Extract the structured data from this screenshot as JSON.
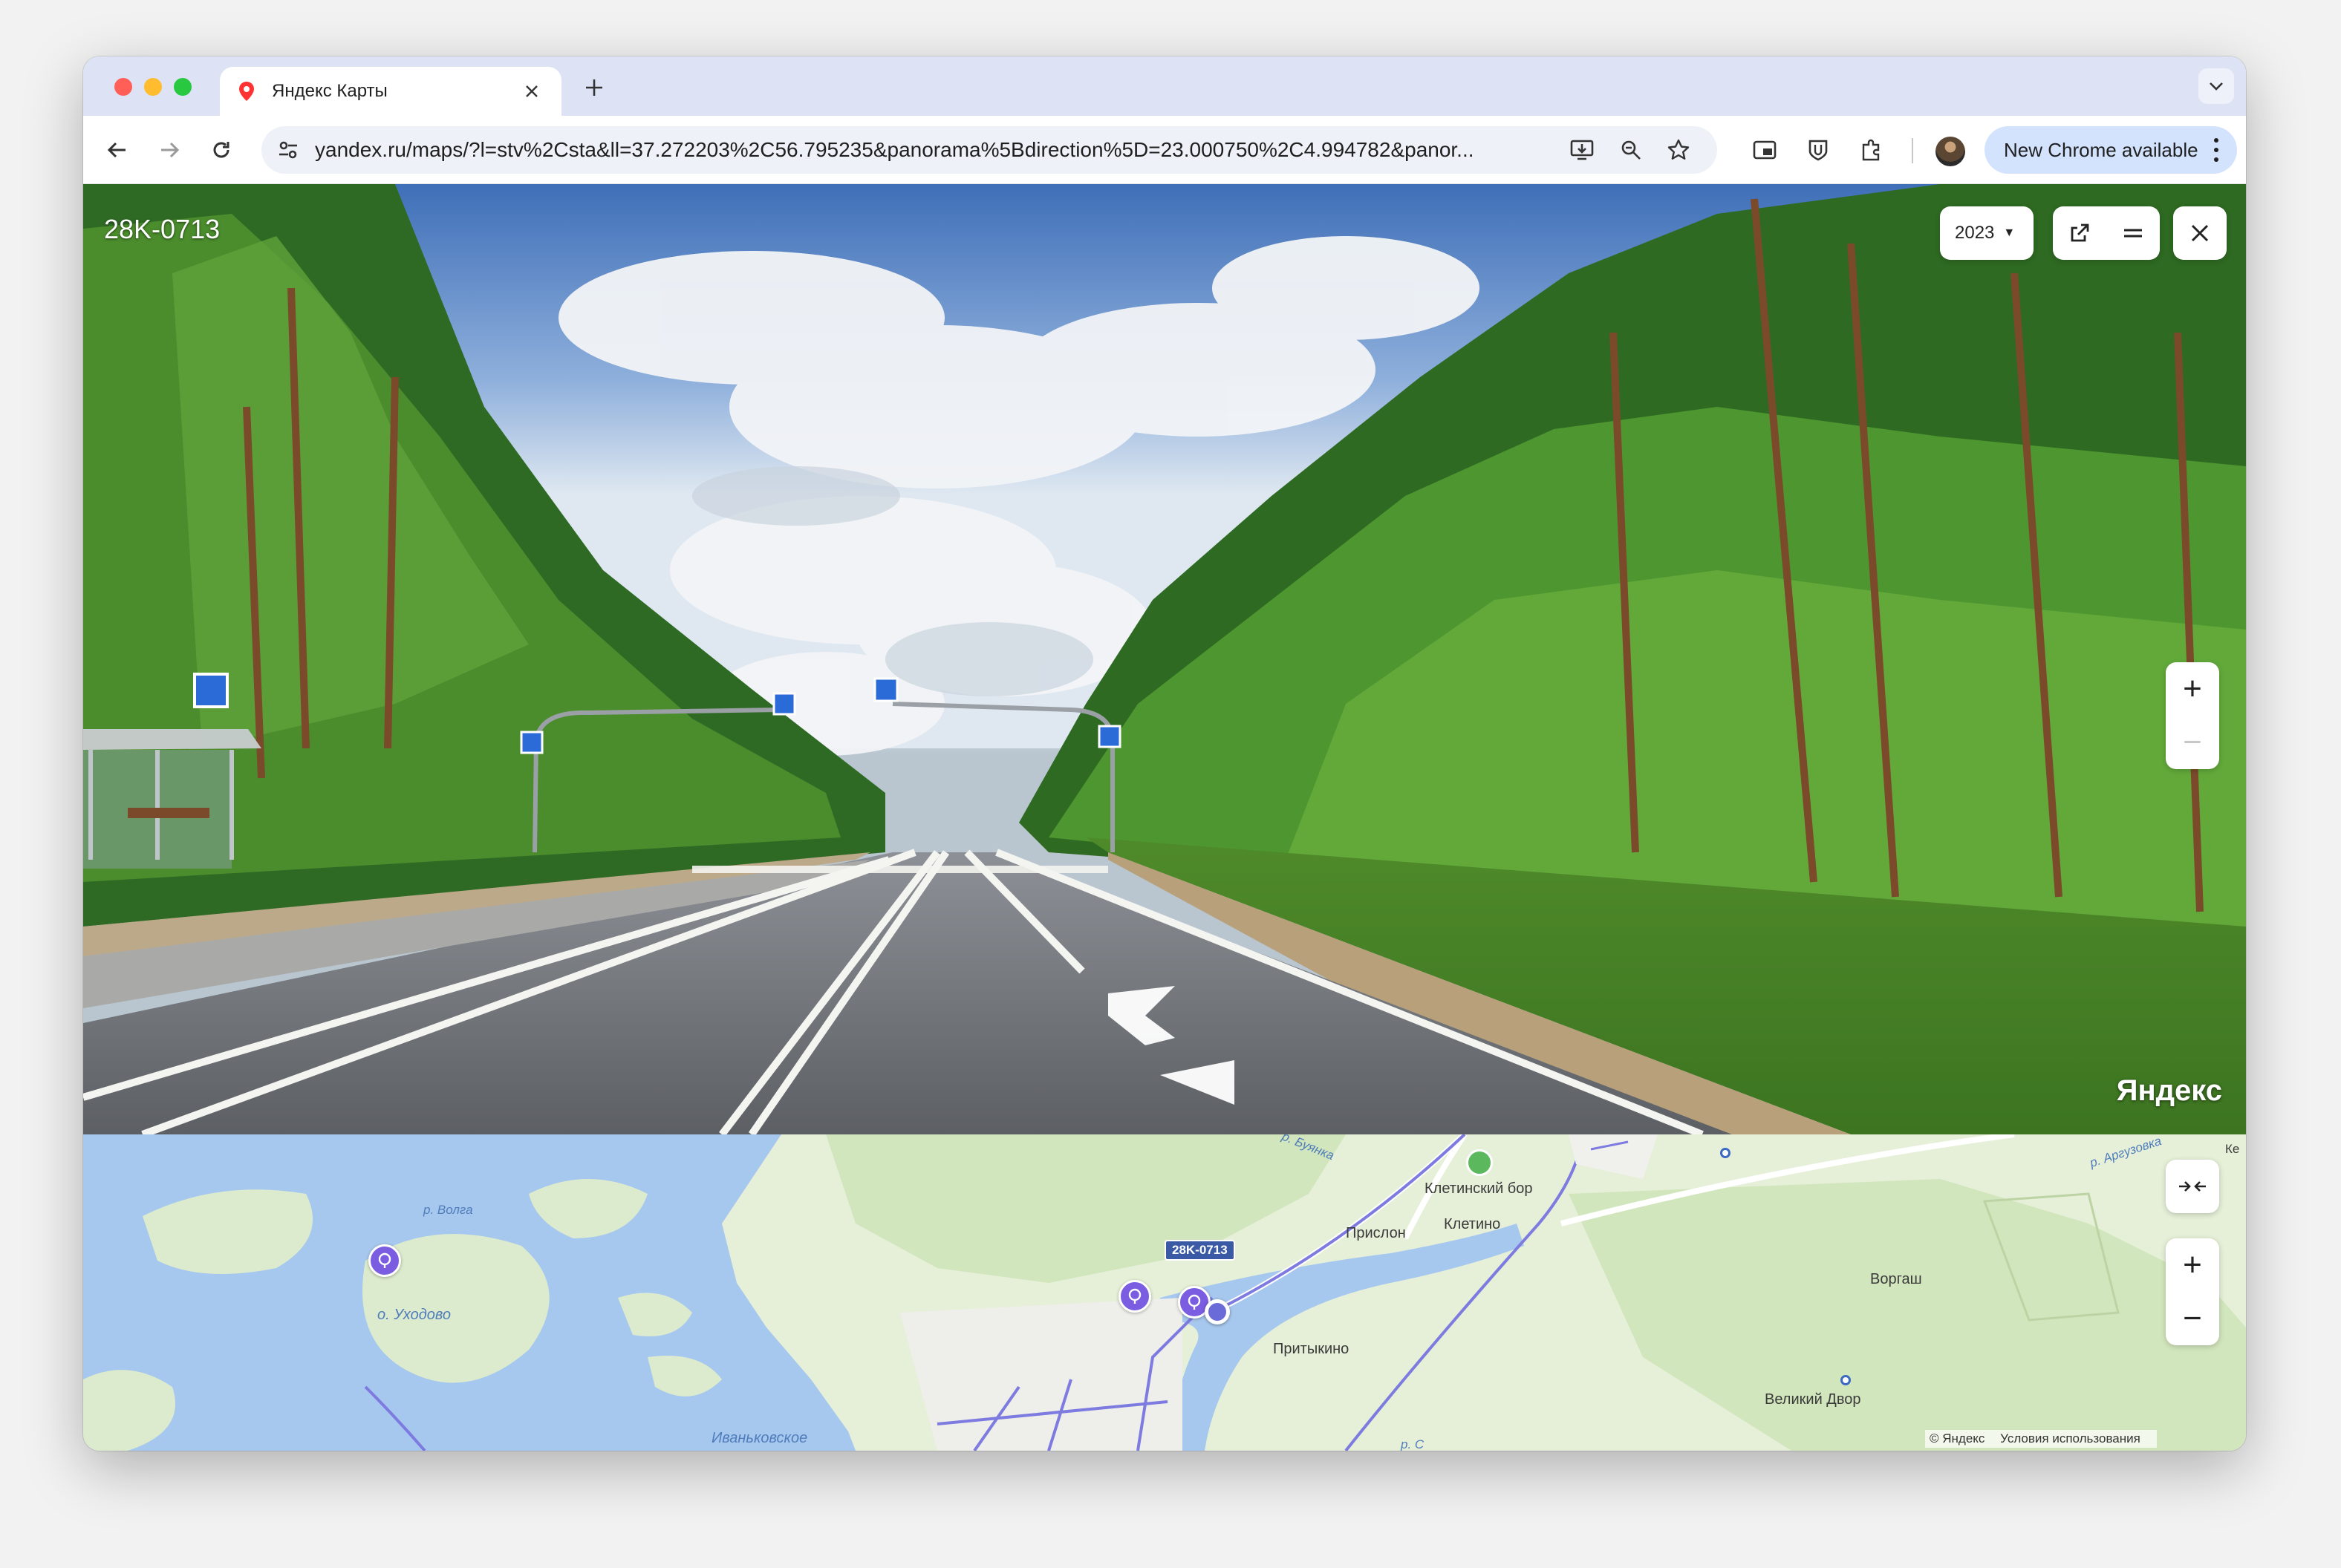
{
  "browser": {
    "tab": {
      "title": "Яндекс Карты"
    },
    "url": "yandex.ru/maps/?l=stv%2Csta&ll=37.272203%2C56.795235&panorama%5Bdirection%5D=23.000750%2C4.994782&panor...",
    "update_label": "New Chrome available"
  },
  "panorama": {
    "road_label": "28K-0713",
    "year": "2023",
    "watermark": "Яндекс",
    "zoom_in": "+",
    "zoom_out": "−"
  },
  "map": {
    "labels": {
      "volga": "р. Волга",
      "uhodovo": "о. Уходово",
      "ivankovskoe": "Иваньковское",
      "buyanka": "р. Буянка",
      "kletinsky_bor": "Клетинский бор",
      "prislon": "Прислон",
      "kletino": "Клетино",
      "pritykino": "Притыкино",
      "vorgash": "Воргаш",
      "veliky_dvor": "Великий Двор",
      "arguzovka": "р. Аргузовка",
      "ke": "Ке",
      "r_s": "р. С"
    },
    "route_badge": "28K-0713",
    "zoom_in": "+",
    "zoom_out": "−",
    "copyright": "© Яндекс",
    "terms": "Условия использования"
  }
}
